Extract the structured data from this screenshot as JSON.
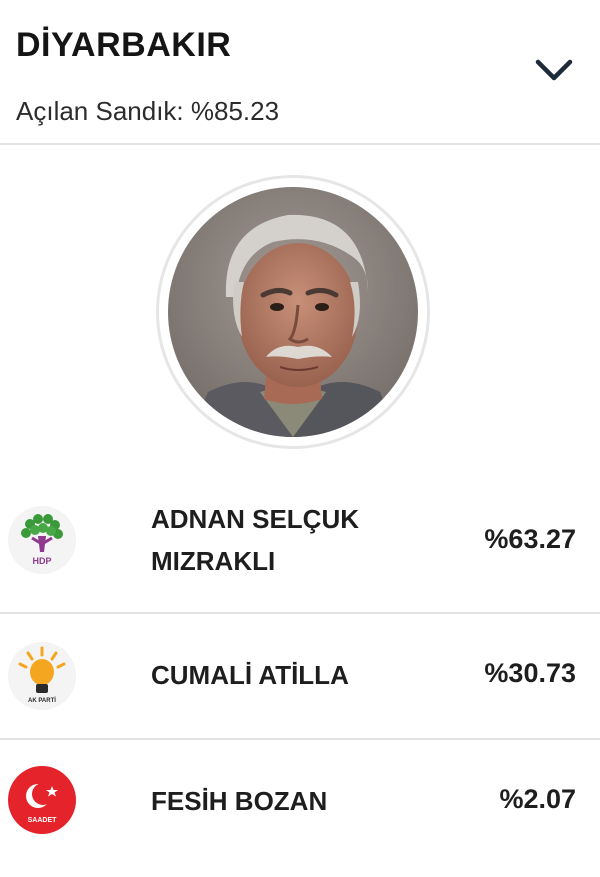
{
  "header": {
    "city": "DİYARBAKIR",
    "opened_label": "Açılan Sandık: %85.23"
  },
  "photo": {
    "alt": "Adnan Selçuk Mızraklı"
  },
  "candidates": [
    {
      "name_line1": "ADNAN SELÇUK",
      "name_line2": "MIZRAKLI",
      "percent": "%63.27",
      "party_logo": "hdp-logo",
      "party_text": "HDP"
    },
    {
      "name_line1": "CUMALİ ATİLLA",
      "name_line2": "",
      "percent": "%30.73",
      "party_logo": "ak-parti-logo",
      "party_text": "AK PARTİ"
    },
    {
      "name_line1": "FESİH BOZAN",
      "name_line2": "",
      "percent": "%2.07",
      "party_logo": "saadet-logo",
      "party_text": "SAADET"
    }
  ],
  "colors": {
    "divider": "#e2e2e2",
    "hdp_green": "#3a9a3a",
    "hdp_purple": "#8e3a8e",
    "ak_yellow": "#f4a621",
    "saadet_red": "#e5232b"
  },
  "icons": {
    "expand": "chevron-down-icon"
  }
}
